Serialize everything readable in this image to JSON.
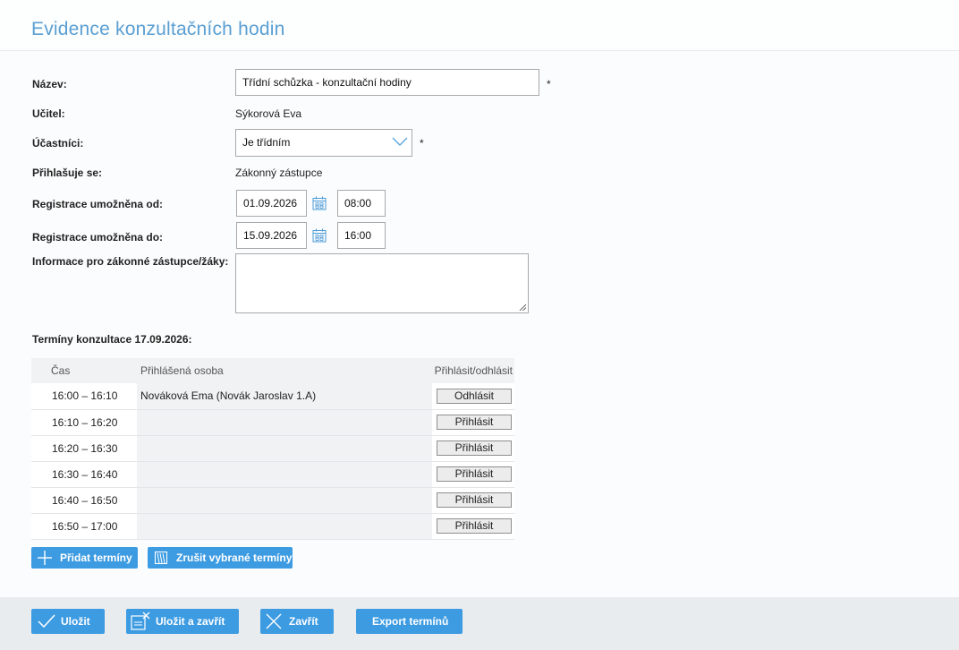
{
  "header": {
    "title": "Evidence konzultačních hodin"
  },
  "form": {
    "name_label": "Název:",
    "name_value": "Třídní schůzka - konzultační hodiny",
    "required_mark": "*",
    "teacher_label": "Učitel:",
    "teacher_value": "Sýkorová Eva",
    "participants_label": "Účastníci:",
    "participants_value": "Je třídním",
    "signs_up_label": "Přihlašuje se:",
    "signs_up_value": "Zákonný zástupce",
    "reg_from_label": "Registrace umožněna od:",
    "reg_from_date": "01.09.2026",
    "reg_from_time": "08:00",
    "reg_to_label": "Registrace umožněna do:",
    "reg_to_date": "15.09.2026",
    "reg_to_time": "16:00",
    "info_label": "Informace pro zákonné zástupce/žáky:",
    "info_value": ""
  },
  "slots": {
    "title": "Termíny konzultace 17.09.2026:",
    "headers": {
      "time": "Čas",
      "person": "Přihlášená osoba",
      "action": "Přihlásit/odhlásit"
    },
    "rows": [
      {
        "time": "16:00 – 16:10",
        "person": "Nováková Ema (Novák Jaroslav 1.A)",
        "action": "Odhlásit"
      },
      {
        "time": "16:10 – 16:20",
        "person": "",
        "action": "Přihlásit"
      },
      {
        "time": "16:20 – 16:30",
        "person": "",
        "action": "Přihlásit"
      },
      {
        "time": "16:30 – 16:40",
        "person": "",
        "action": "Přihlásit"
      },
      {
        "time": "16:40 – 16:50",
        "person": "",
        "action": "Přihlásit"
      },
      {
        "time": "16:50 – 17:00",
        "person": "",
        "action": "Přihlásit"
      }
    ],
    "add_label": "Přidat termíny",
    "cancel_label": "Zrušit vybrané termíny"
  },
  "footer": {
    "save_label": "Uložit",
    "save_close_label": "Uložit a zavřít",
    "close_label": "Zavřít",
    "export_label": "Export termínů"
  },
  "colors": {
    "accent": "#3d9be2",
    "title": "#5a9fd3",
    "footer_bg": "#e9ecef"
  },
  "icons": [
    "chevron-down-icon",
    "calendar-icon",
    "plus-icon",
    "cancel-slots-icon",
    "check-icon",
    "save-close-icon",
    "close-icon"
  ]
}
